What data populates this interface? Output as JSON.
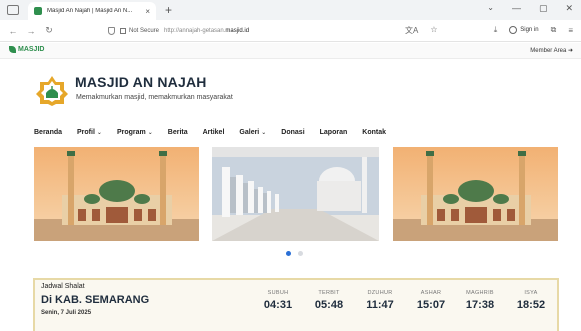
{
  "browser": {
    "tab_title": "Masjid An Najah | Masjid An N...",
    "tab_close": "×",
    "new_tab": "+",
    "not_secure": "Not Secure",
    "url_prefix": "http://annajah-getasan.",
    "url_domain": "masjid.id"
  },
  "site": {
    "brand": "MASJID",
    "member_area": "Member Area ➜",
    "title": "MASJID AN NAJAH",
    "subtitle": "Memakmurkan masjid, memakmurkan masyarakat"
  },
  "menu": [
    {
      "label": "Beranda",
      "dropdown": false
    },
    {
      "label": "Profil",
      "dropdown": true
    },
    {
      "label": "Program",
      "dropdown": true
    },
    {
      "label": "Berita",
      "dropdown": false
    },
    {
      "label": "Artikel",
      "dropdown": false
    },
    {
      "label": "Galeri",
      "dropdown": true
    },
    {
      "label": "Donasi",
      "dropdown": false
    },
    {
      "label": "Laporan",
      "dropdown": false
    },
    {
      "label": "Kontak",
      "dropdown": false
    }
  ],
  "slider": {
    "count": 2,
    "active": 0
  },
  "prayer": {
    "label": "Jadwal Shalat",
    "location": "Di KAB. SEMARANG",
    "date": "Senin, 7 Juli 2025",
    "times": [
      {
        "name": "SUBUH",
        "time": "04:31"
      },
      {
        "name": "TERBIT",
        "time": "05:48"
      },
      {
        "name": "DZUHUR",
        "time": "11:47"
      },
      {
        "name": "ASHAR",
        "time": "15:07"
      },
      {
        "name": "MAGHRIB",
        "time": "17:38"
      },
      {
        "name": "ISYA",
        "time": "18:52"
      }
    ]
  },
  "colors": {
    "brand_green": "#2f8f4e",
    "panel_border": "#e7d9a6",
    "dot_active": "#2a6fd6"
  }
}
